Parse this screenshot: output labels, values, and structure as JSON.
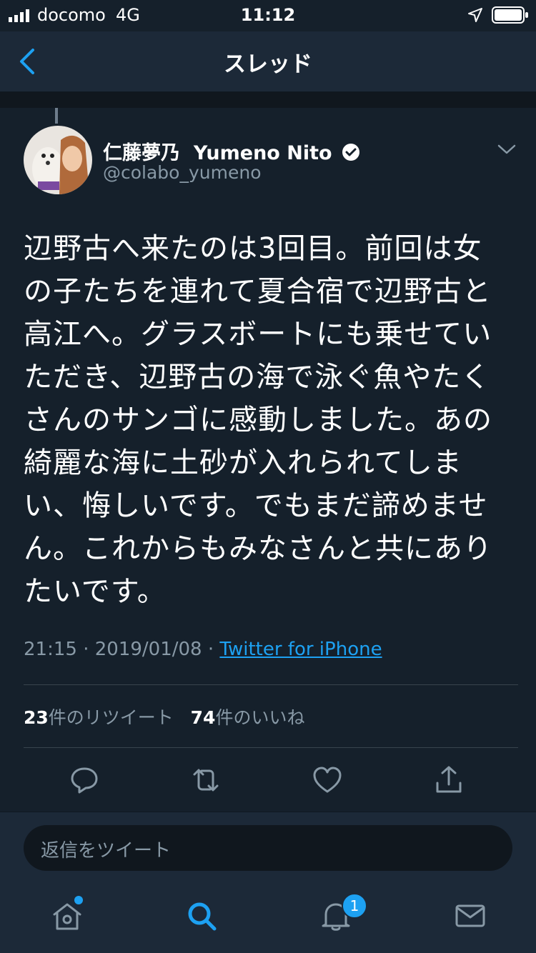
{
  "status_bar": {
    "carrier": "docomo",
    "network": "4G",
    "time": "11:12"
  },
  "nav": {
    "title": "スレッド"
  },
  "tweet": {
    "display_name": "仁藤夢乃",
    "display_name_en": "Yumeno Nito",
    "handle": "@colabo_yumeno",
    "text_lines": [
      "辺野古へ来たのは3回目。前回は女",
      "の子たちを連れて夏合宿で辺野古と",
      "高江へ。グラスボートにも乗せてい",
      "ただき、辺野古の海で泳ぐ魚やたく",
      "さんのサンゴに感動しました。あの",
      "綺麗な海に土砂が入れられてしま",
      "い、悔しいです。でもまだ諦めませ",
      "ん。これからもみなさんと共にあり",
      "たいです。"
    ],
    "time": "21:15",
    "date": "2019/01/08",
    "separator": " · ",
    "source": "Twitter for iPhone",
    "retweet_count": "23",
    "retweet_label": "件のリツイート",
    "like_count": "74",
    "like_label": "件のいいね"
  },
  "reply": {
    "placeholder": "返信をツイート"
  },
  "tabbar": {
    "notification_badge": "1"
  },
  "colors": {
    "background": "#15202b",
    "accent": "#1da1f2",
    "secondary_text": "#8899a6"
  }
}
